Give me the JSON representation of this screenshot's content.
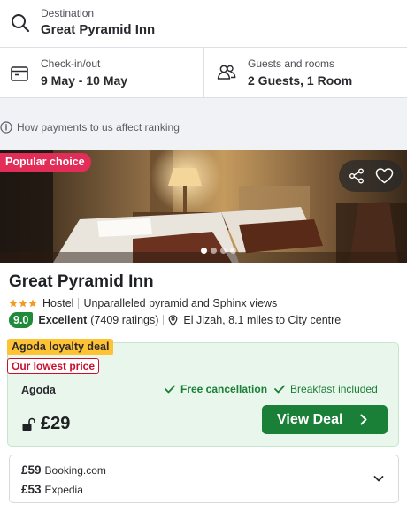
{
  "search": {
    "destination_label": "Destination",
    "destination_value": "Great Pyramid Inn",
    "dates_label": "Check-in/out",
    "dates_value": "9 May - 10 May",
    "guests_label": "Guests and rooms",
    "guests_value": "2 Guests, 1 Room",
    "icons": [
      "search-icon",
      "calendar-icon",
      "guests-icon"
    ]
  },
  "ranking_info": "How payments to us affect ranking",
  "property": {
    "badge": "Popular choice",
    "photo_count": 4,
    "active_photo_index": 0,
    "name": "Great Pyramid Inn",
    "star_rating": 3,
    "type": "Hostel",
    "highlight": "Unparalleled pyramid and Sphinx views",
    "score": "9.0",
    "score_word": "Excellent",
    "ratings_count": "(7409 ratings)",
    "location": "El Jizah, 8.1 miles to City centre",
    "colors": {
      "badge": "#e12d58",
      "score": "#1f8a3a",
      "deal_button": "#1a7f37",
      "loyalty": "#ffc233",
      "lowest": "#c8102e"
    }
  },
  "deal": {
    "loyalty_label": "Agoda loyalty deal",
    "lowest_label": "Our lowest price",
    "provider": "Agoda",
    "free_cancellation": "Free cancellation",
    "breakfast": "Breakfast included",
    "price": "£29",
    "button_label": "View Deal"
  },
  "other_prices": [
    {
      "price": "£59",
      "site": "Booking.com"
    },
    {
      "price": "£53",
      "site": "Expedia"
    }
  ]
}
